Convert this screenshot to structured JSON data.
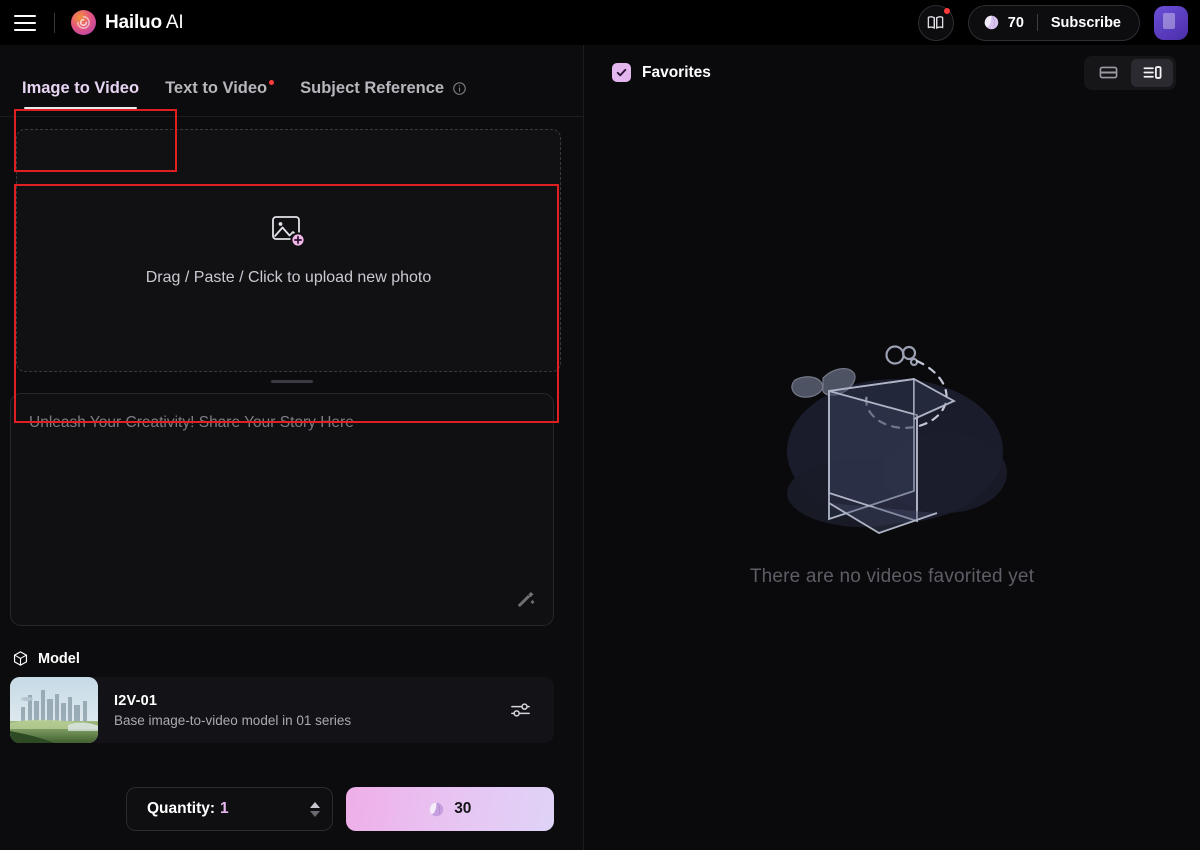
{
  "header": {
    "menu_icon": "hamburger-icon",
    "logo_icon": "hailuo-spiral-logo",
    "brand": "Hailuo",
    "brand_suffix": "AI",
    "guide_icon": "book-guide-icon",
    "guide_badge": true,
    "credits_icon": "gem-credit-icon",
    "credits": "70",
    "subscribe_label": "Subscribe",
    "avatar_label": "user-avatar"
  },
  "left": {
    "tabs": [
      {
        "label": "Image to Video",
        "active": true,
        "dot": false,
        "info": false
      },
      {
        "label": "Text to Video",
        "active": false,
        "dot": true,
        "info": false
      },
      {
        "label": "Subject Reference",
        "active": false,
        "dot": false,
        "info": true
      }
    ],
    "dropzone": {
      "icon": "image-add-icon",
      "text": "Drag / Paste / Click to upload new photo"
    },
    "prompt": {
      "placeholder": "Unleash Your Creativity! Share Your Story Here",
      "value": "",
      "magic_icon": "magic-wand-icon"
    },
    "model_section": {
      "icon": "cube-icon",
      "label": "Model",
      "card": {
        "name": "I2V-01",
        "description": "Base image-to-video model in 01 series",
        "settings_icon": "sliders-icon",
        "thumbnail": "futuristic-cityscape"
      }
    },
    "footer": {
      "quantity_label": "Quantity:",
      "quantity_value": "1",
      "generate_icon": "gem-credit-icon",
      "generate_cost": "30"
    }
  },
  "right": {
    "favorites_label": "Favorites",
    "favorites_checked": true,
    "view_modes": [
      {
        "name": "grid-view",
        "icon": "list-rows-icon",
        "active": false
      },
      {
        "name": "split-view",
        "icon": "sidebar-panel-icon",
        "active": true
      }
    ],
    "empty": {
      "illustration": "empty-open-box-illustration",
      "text": "There are no videos favorited yet"
    }
  },
  "colors": {
    "accent_pink": "#e3b6f0",
    "active_tab": "#e7d4f2",
    "annotation_red": "#e02020",
    "badge_red": "#ff3b3b",
    "page_bg": "#0a0a0c"
  }
}
